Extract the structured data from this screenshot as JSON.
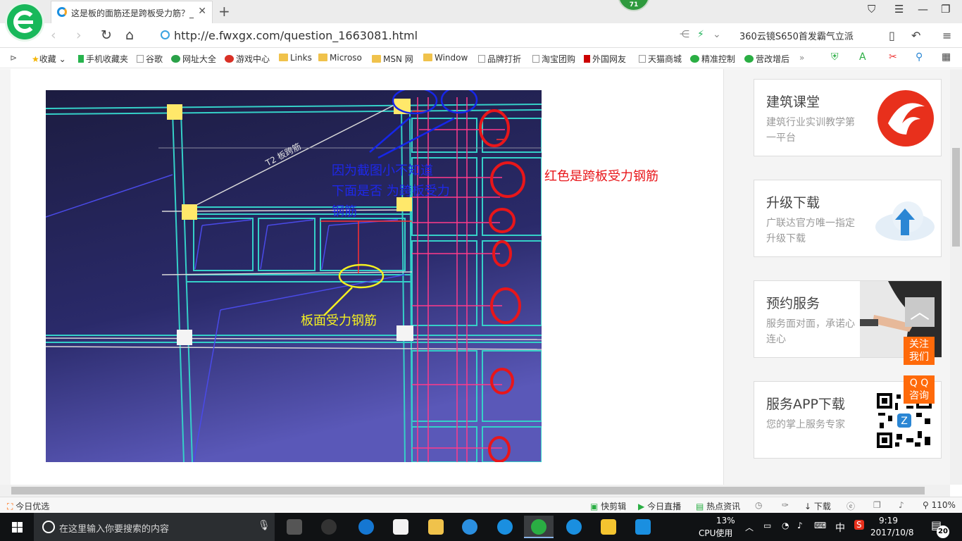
{
  "browser": {
    "tab_title": "这是板的面筋还是跨板受力筋？_",
    "notification_count": "71",
    "url": "http://e.fwxgx.com/question_1663081.html",
    "search_text": "360云镜S650首发霸气立派"
  },
  "bookmarks": [
    {
      "label": "收藏",
      "icon": "star-icon"
    },
    {
      "label": "手机收藏夹",
      "icon": "phone-icon"
    },
    {
      "label": "谷歌",
      "icon": "page-icon"
    },
    {
      "label": "网址大全",
      "icon": "globe-icon"
    },
    {
      "label": "游戏中心",
      "icon": "game-icon"
    },
    {
      "label": "Links",
      "icon": "folder-icon"
    },
    {
      "label": "Microso",
      "icon": "folder-icon"
    },
    {
      "label": "MSN 网",
      "icon": "folder-icon"
    },
    {
      "label": "Window",
      "icon": "folder-icon"
    },
    {
      "label": "品牌打折",
      "icon": "page-icon"
    },
    {
      "label": "淘宝团购",
      "icon": "page-icon"
    },
    {
      "label": "外国网友",
      "icon": "page-icon"
    },
    {
      "label": "天猫商城",
      "icon": "page-icon"
    },
    {
      "label": "精准控制",
      "icon": "wechat-icon"
    },
    {
      "label": "营改增后",
      "icon": "wechat-icon"
    }
  ],
  "photo": {
    "annotation_blue": "因为截图小不知道\n下面是否 为跨板受力\n钢筋",
    "annotation_yellow": "板面受力钢筋",
    "plan_label": "T2 板跨筋"
  },
  "annotation_red": "红色是跨板受力钢筋",
  "sidebar": [
    {
      "title": "建筑课堂",
      "desc": "建筑行业实训教学第一平台",
      "icon": "swirl-logo-icon",
      "accent": "#e8301c"
    },
    {
      "title": "升级下载",
      "desc": "广联达官方唯一指定升级下载",
      "icon": "cloud-upload-icon",
      "accent": "#2a86d4"
    },
    {
      "title": "预约服务",
      "desc": "服务面对面，承诺心连心",
      "icon": "handshake-photo",
      "accent": "#444444"
    },
    {
      "title": "服务APP下载",
      "desc": "您的掌上服务专家",
      "icon": "qr-code-icon",
      "accent": "#000000"
    }
  ],
  "float_buttons": {
    "back_top": "︿",
    "follow": "关注\n我们",
    "qq": "Q Q\n咨询"
  },
  "statusbar": {
    "today": "今日优选",
    "items": [
      "快剪辑",
      "今日直播",
      "热点资讯"
    ],
    "download": "下载",
    "zoom": "110%"
  },
  "taskbar": {
    "search_placeholder": "在这里输入你要搜索的内容",
    "cpu_percent": "13%",
    "cpu_label": "CPU使用",
    "ime": "中",
    "time": "9:19",
    "date": "2017/10/8",
    "notification_count": "20"
  }
}
